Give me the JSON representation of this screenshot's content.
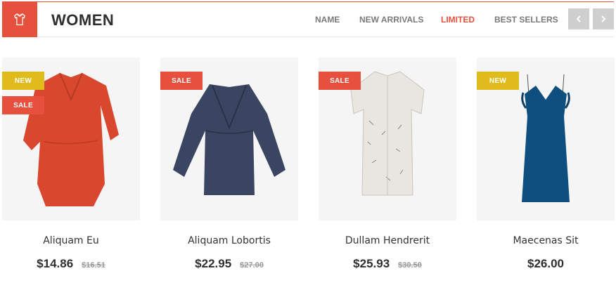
{
  "header": {
    "title": "WOMEN",
    "icon": "shirt-icon",
    "accent_color": "#e8503e"
  },
  "tabs": [
    {
      "label": "NAME",
      "active": false
    },
    {
      "label": "NEW ARRIVALS",
      "active": false
    },
    {
      "label": "LIMITED",
      "active": true
    },
    {
      "label": "BEST SELLERS",
      "active": false
    }
  ],
  "nav": {
    "prev_icon": "chevron-left-icon",
    "next_icon": "chevron-right-icon"
  },
  "products": [
    {
      "name": "Aliquam Eu",
      "price": "$14.86",
      "old_price": "$16.51",
      "badges": [
        "NEW",
        "SALE"
      ],
      "dress_color": "#d9472e"
    },
    {
      "name": "Aliquam Lobortis",
      "price": "$22.95",
      "old_price": "$27.00",
      "badges": [
        "SALE"
      ],
      "dress_color": "#3a4562"
    },
    {
      "name": "Dullam Hendrerit",
      "price": "$25.93",
      "old_price": "$30.50",
      "badges": [
        "SALE"
      ],
      "dress_color": "#e9e6e2"
    },
    {
      "name": "Maecenas Sit",
      "price": "$26.00",
      "old_price": "",
      "badges": [
        "NEW"
      ],
      "dress_color": "#0f4f80"
    }
  ],
  "badge_colors": {
    "NEW": "#e0bb1c",
    "SALE": "#e8503e"
  }
}
